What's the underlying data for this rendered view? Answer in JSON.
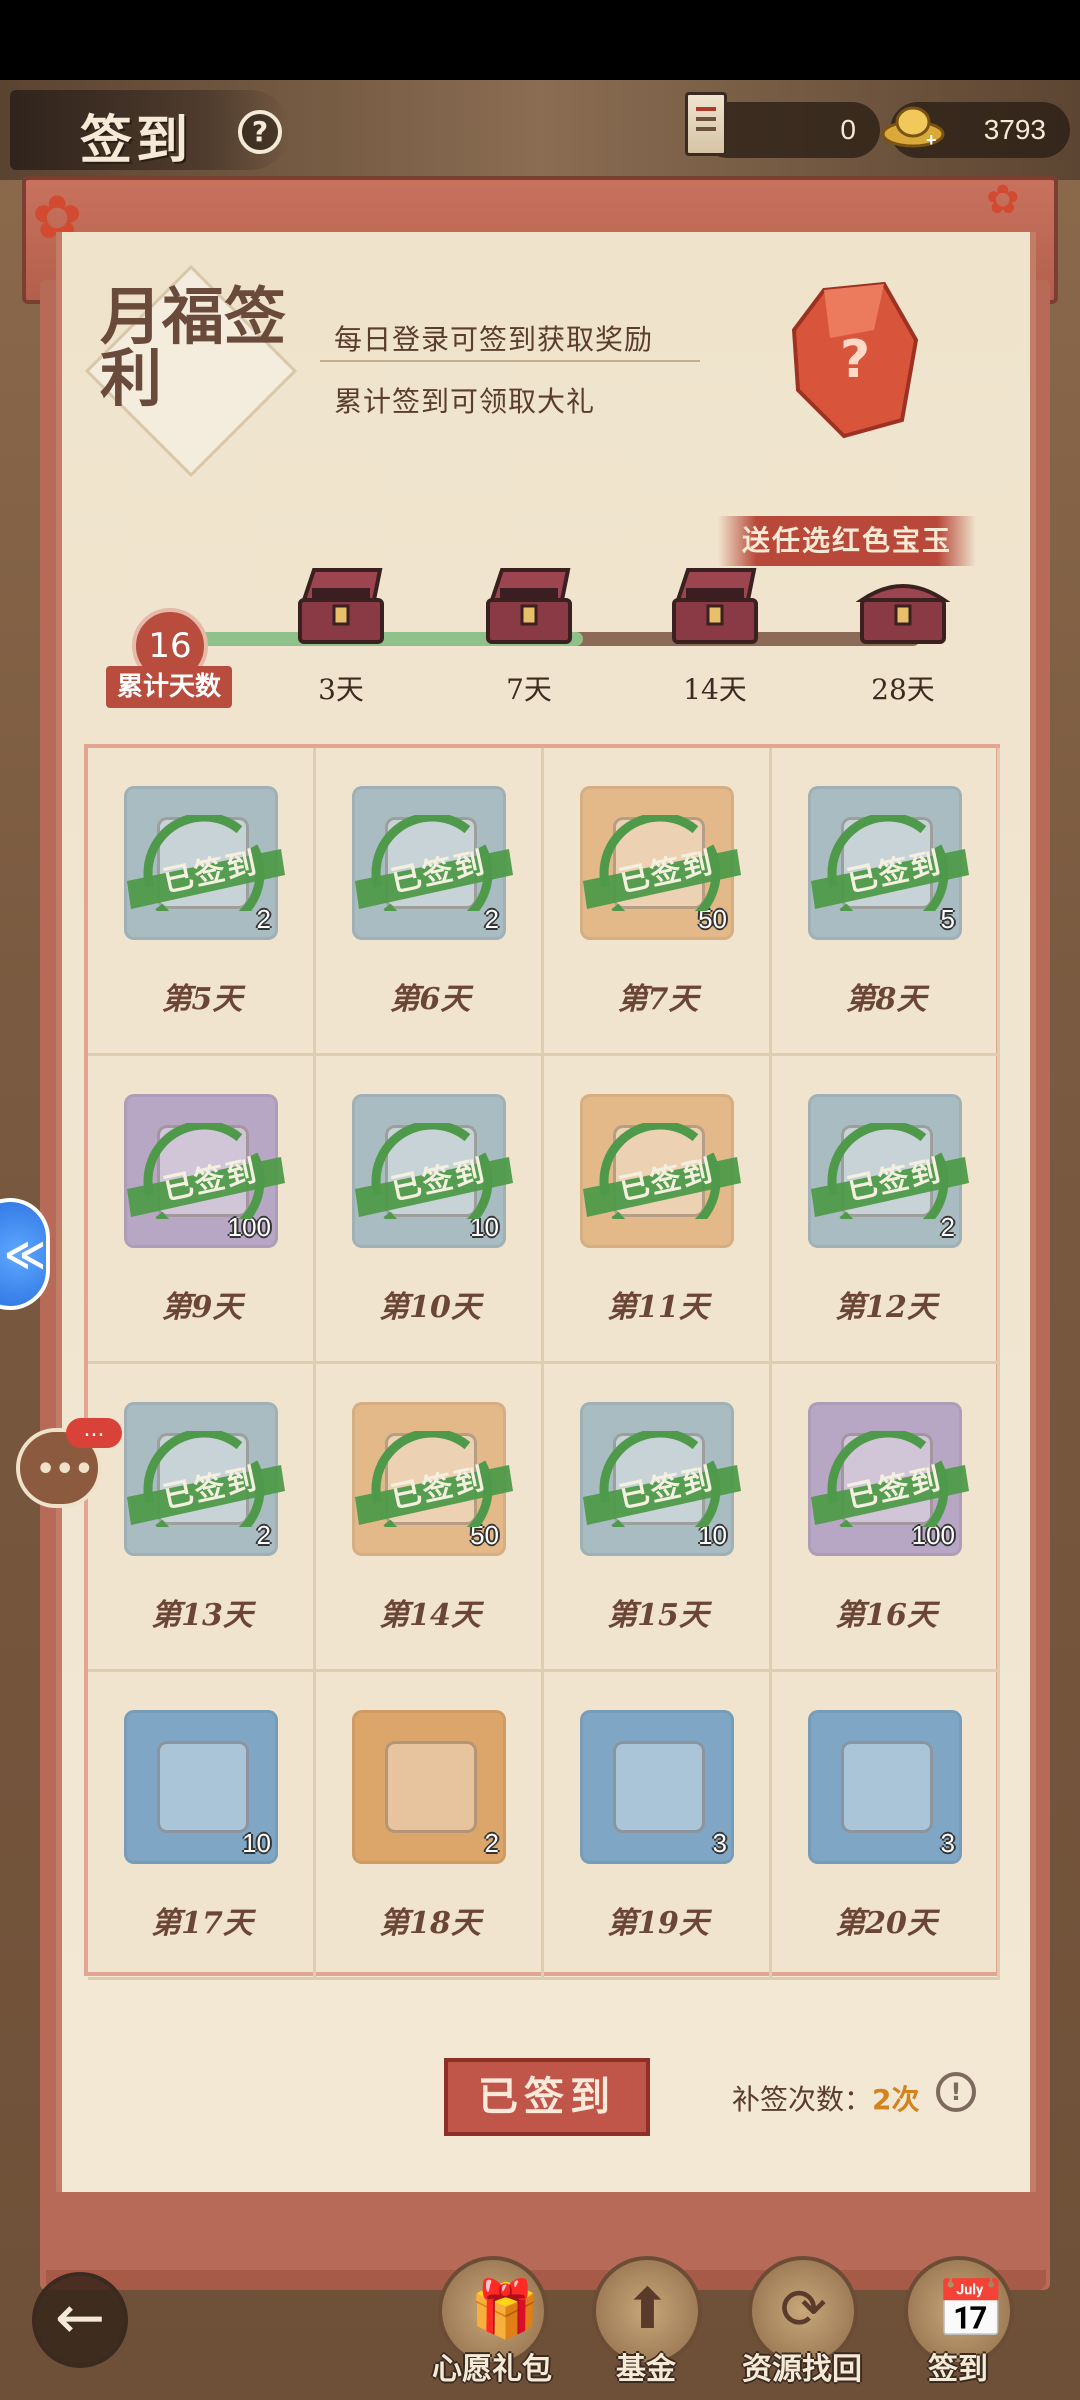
{
  "header": {
    "title": "签到",
    "help_icon": "question-icon",
    "resources": [
      {
        "icon": "book-icon",
        "value": "0"
      },
      {
        "icon": "gold-ingot-icon",
        "value": "3793"
      }
    ]
  },
  "banner": {
    "calligraphy": "月福签利",
    "line1": "每日登录可签到获取奖励",
    "line2": "累计签到可领取大礼",
    "gem_ribbon": "送任选红色宝玉",
    "gem_question": "?"
  },
  "progress": {
    "days_value": "16",
    "days_label": "累计天数",
    "fraction": 0.55,
    "milestones": [
      "3天",
      "7天",
      "14天",
      "28天"
    ]
  },
  "grid": {
    "stamp_text": "已签到",
    "cells": [
      {
        "day": "第5天",
        "count": "2",
        "bg": "#a9bcc2",
        "signed": true
      },
      {
        "day": "第6天",
        "count": "2",
        "bg": "#a9bcc2",
        "signed": true
      },
      {
        "day": "第7天",
        "count": "50",
        "bg": "#e3b98a",
        "signed": true
      },
      {
        "day": "第8天",
        "count": "5",
        "bg": "#a9bcc2",
        "signed": true
      },
      {
        "day": "第9天",
        "count": "100",
        "bg": "#b8a7c4",
        "signed": true
      },
      {
        "day": "第10天",
        "count": "10",
        "bg": "#a9bcc2",
        "signed": true
      },
      {
        "day": "第11天",
        "count": "",
        "bg": "#e3b98a",
        "signed": true
      },
      {
        "day": "第12天",
        "count": "2",
        "bg": "#a9bcc2",
        "signed": true
      },
      {
        "day": "第13天",
        "count": "2",
        "bg": "#a9bcc2",
        "signed": true
      },
      {
        "day": "第14天",
        "count": "50",
        "bg": "#e3b98a",
        "signed": true
      },
      {
        "day": "第15天",
        "count": "10",
        "bg": "#a9bcc2",
        "signed": true
      },
      {
        "day": "第16天",
        "count": "100",
        "bg": "#b8a7c4",
        "signed": true
      },
      {
        "day": "第17天",
        "count": "10",
        "bg": "#7fa6c4",
        "signed": false
      },
      {
        "day": "第18天",
        "count": "2",
        "bg": "#dca56a",
        "signed": false
      },
      {
        "day": "第19天",
        "count": "3",
        "bg": "#7fa6c4",
        "signed": false
      },
      {
        "day": "第20天",
        "count": "3",
        "bg": "#7fa6c4",
        "signed": false
      }
    ]
  },
  "footer": {
    "signed_button": "已签到",
    "retro_label": "补签次数：",
    "retro_value": "2次",
    "info_icon": "!"
  },
  "nav": {
    "back_icon": "arrow-left-icon",
    "items": [
      {
        "label": "心愿礼包",
        "icon": "gift-icon"
      },
      {
        "label": "基金",
        "icon": "fund-icon"
      },
      {
        "label": "资源找回",
        "icon": "recover-icon"
      },
      {
        "label": "签到",
        "icon": "calendar-icon"
      }
    ]
  },
  "side": {
    "chat_badge": "..."
  },
  "colors": {
    "accent_red": "#b84d3e",
    "progress_green": "#8fc18a",
    "stamp_green": "#4f9a4a",
    "paper": "#f0e4ce"
  }
}
